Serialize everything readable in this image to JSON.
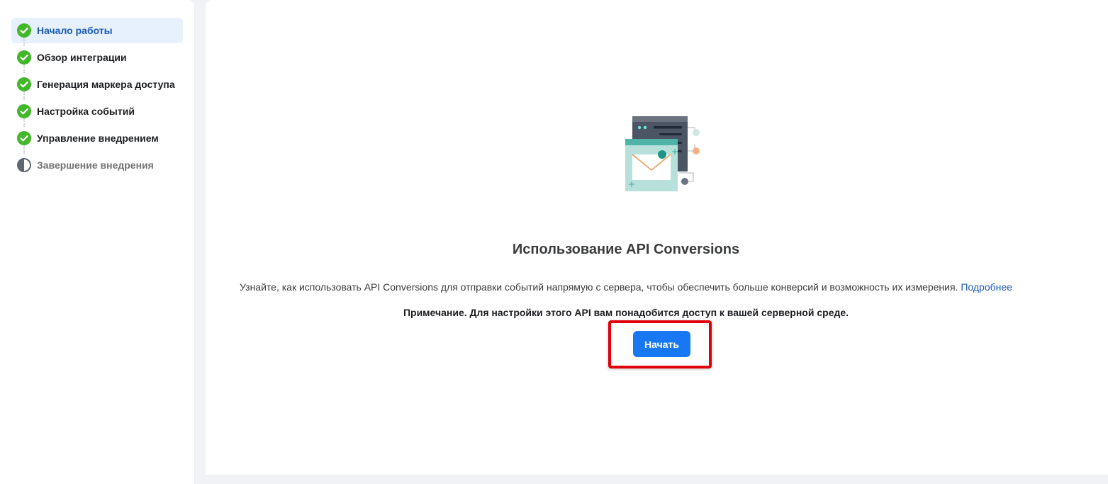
{
  "sidebar": {
    "steps": [
      {
        "label": "Начало работы",
        "status": "completed",
        "active": true
      },
      {
        "label": "Обзор интеграции",
        "status": "completed",
        "active": false
      },
      {
        "label": "Генерация маркера доступа",
        "status": "completed",
        "active": false
      },
      {
        "label": "Настройка событий",
        "status": "completed",
        "active": false
      },
      {
        "label": "Управление внедрением",
        "status": "completed",
        "active": false
      },
      {
        "label": "Завершение внедрения",
        "status": "in-progress",
        "active": false
      }
    ],
    "icons": {
      "completed": "check-circle-icon",
      "in-progress": "half-circle-icon"
    }
  },
  "main": {
    "illustration": "server-envelope-illustration",
    "title": "Использование API Conversions",
    "description": "Узнайте, как использовать API Conversions для отправки событий напрямую с сервера, чтобы обеспечить больше конверсий и возможность их измерения.",
    "learn_more_link": "Подробнее",
    "note": "Примечание. Для настройки этого API вам понадобится доступ к вашей серверной среде.",
    "start_button_label": "Начать"
  },
  "colors": {
    "accent": "#1877f2",
    "active_step_bg": "#e7f0fd",
    "active_step_text": "#1b5ab5",
    "check_green": "#42b72a",
    "highlight_red": "#e0000b"
  }
}
